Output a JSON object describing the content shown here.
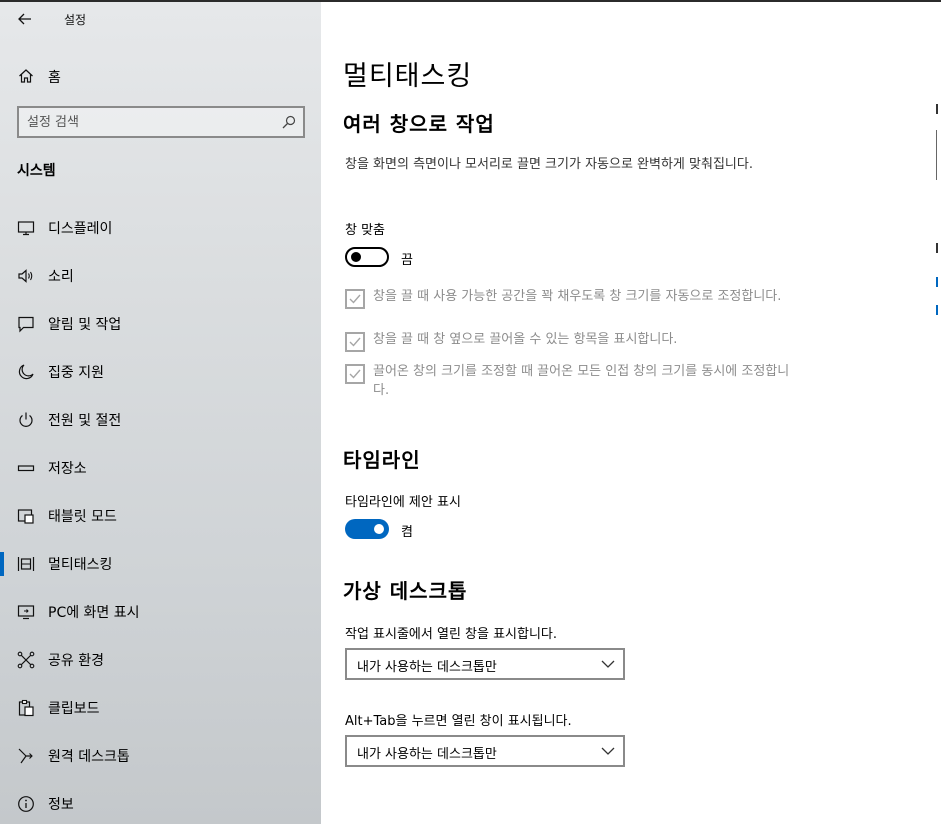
{
  "app": {
    "title": "설정"
  },
  "sidebar": {
    "home_label": "홈",
    "search_placeholder": "설정 검색",
    "section_title": "시스템",
    "items": [
      {
        "label": "디스플레이",
        "icon": "monitor-icon"
      },
      {
        "label": "소리",
        "icon": "speaker-icon"
      },
      {
        "label": "알림 및 작업",
        "icon": "message-icon"
      },
      {
        "label": "집중 지원",
        "icon": "moon-icon"
      },
      {
        "label": "전원 및 절전",
        "icon": "power-icon"
      },
      {
        "label": "저장소",
        "icon": "storage-icon"
      },
      {
        "label": "태블릿 모드",
        "icon": "tablet-icon"
      },
      {
        "label": "멀티태스킹",
        "icon": "multitasking-icon",
        "active": true
      },
      {
        "label": "PC에 화면 표시",
        "icon": "project-icon"
      },
      {
        "label": "공유 환경",
        "icon": "share-icon"
      },
      {
        "label": "클립보드",
        "icon": "clipboard-icon"
      },
      {
        "label": "원격 데스크톱",
        "icon": "remote-icon"
      },
      {
        "label": "정보",
        "icon": "info-icon"
      }
    ]
  },
  "main": {
    "title": "멀티태스킹",
    "snap": {
      "heading": "여러 창으로 작업",
      "description": "창을 화면의 측면이나 모서리로 끌면 크기가 자동으로 완벽하게 맞춰집니다.",
      "toggle_label": "창 맞춤",
      "toggle_state": "끔",
      "options": [
        "창을 끌 때 사용 가능한 공간을 꽉 채우도록 창 크기를 자동으로 조정합니다.",
        "창을 끌 때 창 옆으로 끌어올 수 있는 항목을 표시합니다.",
        "끌어온 창의 크기를 조정할 때 끌어온 모든 인접 창의 크기를 동시에 조정합니다."
      ]
    },
    "timeline": {
      "heading": "타임라인",
      "toggle_label": "타임라인에 제안 표시",
      "toggle_state": "켬"
    },
    "virtual_desktops": {
      "heading": "가상 데스크톱",
      "taskbar_label": "작업 표시줄에서 열린 창을 표시합니다.",
      "taskbar_value": "내가 사용하는 데스크톱만",
      "alttab_label": "Alt+Tab을 누르면 열린 창이 표시됩니다.",
      "alttab_value": "내가 사용하는 데스크톱만"
    }
  },
  "colors": {
    "accent": "#0067c0",
    "disabled_text": "#8c8c8c"
  }
}
